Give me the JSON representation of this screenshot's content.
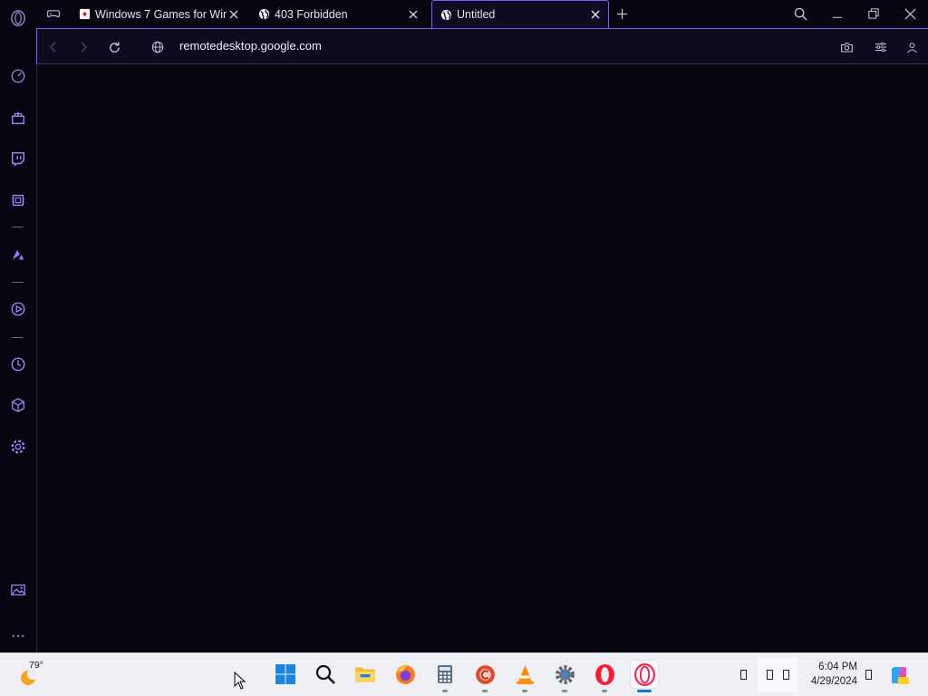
{
  "tabs": [
    {
      "title": "Windows 7 Games for Win",
      "favicon": "solitaire-card-icon",
      "active": false
    },
    {
      "title": "403 Forbidden",
      "favicon": "globe-icon",
      "active": false
    },
    {
      "title": "Untitled",
      "favicon": "globe-icon",
      "active": true
    }
  ],
  "address_bar": {
    "url": "remotedesktop.google.com"
  },
  "sidebar": {
    "items": [
      "opera-logo-icon",
      "speed-dial-icon",
      "shopping-icon",
      "twitch-icon",
      "hardware-monitor-icon",
      "aria-icon",
      "player-icon",
      "history-icon",
      "extensions-icon",
      "settings-icon",
      "pinboard-icon",
      "more-icon"
    ]
  },
  "taskbar": {
    "weather": {
      "temperature": "79°"
    },
    "clock": {
      "time": "6:04 PM",
      "date": "4/29/2024"
    },
    "apps": [
      "start-icon",
      "search-icon",
      "file-explorer-icon",
      "firefox-icon",
      "calculator-icon",
      "ccleaner-icon",
      "vlc-icon",
      "settings-icon",
      "opera-icon",
      "opera-gx-icon"
    ]
  },
  "colors": {
    "accent": "#7a5cff",
    "background": "#07050f",
    "toolbar": "#0e0a1f",
    "taskbar": "#eef0f6"
  }
}
